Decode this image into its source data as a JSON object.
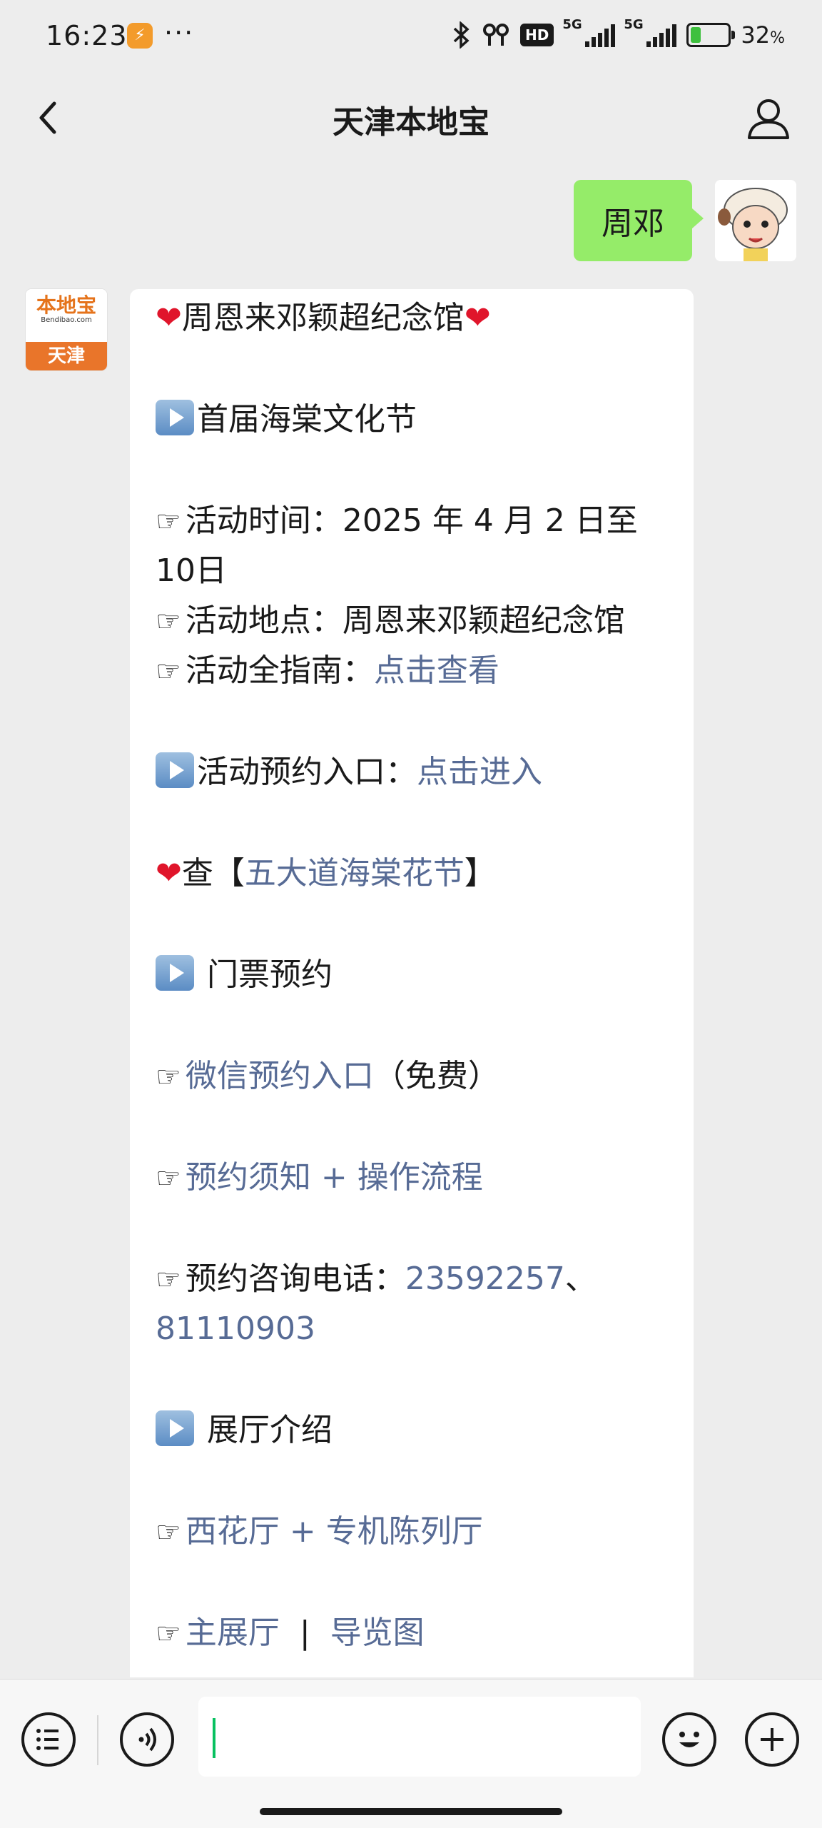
{
  "status_bar": {
    "time": "16:23",
    "more": "···",
    "network_1": "5G",
    "network_2": "5G",
    "hd_badge": "HD",
    "battery_percent": "32",
    "percent_sign": "%",
    "battery_level": 0.32,
    "icons": [
      "bluetooth-icon",
      "earbuds-icon",
      "signal-icon",
      "battery-charging-icon"
    ]
  },
  "header": {
    "title": "天津本地宝",
    "back_icon": "chevron-left-icon",
    "profile_icon": "person-icon"
  },
  "chat": {
    "user_message": "周邓",
    "bot_avatar": {
      "logo_text": "本地宝",
      "url_text": "Bendibao.com",
      "city": "天津"
    },
    "message": {
      "title": "周恩来邓颖超纪念馆",
      "section1_title": "首届海棠文化节",
      "time_label": "活动时间：",
      "time_value": "2025 年 4 月 2 日至",
      "time_value_cont": "10日",
      "place_label": "活动地点：",
      "place_value": "周恩来邓颖超纪念馆",
      "guide_label": "活动全指南：",
      "guide_link": "点击查看",
      "booking_label": "活动预约入口：",
      "booking_link": "点击进入",
      "check_prefix": "查【",
      "check_link": "五大道海棠花节",
      "check_suffix": "】",
      "section2_title": "门票预约",
      "wechat_link": "微信预约入口",
      "wechat_suffix": "（免费）",
      "notice_link": "预约须知 + 操作流程",
      "phone_label": "预约咨询电话：",
      "phone_1": "23592257",
      "phone_sep": "、",
      "phone_2": "81110903",
      "section3_title": "展厅介绍",
      "hall_link": "西花厅 + 专机陈列厅",
      "main_hall_link": "主展厅",
      "divider": "|",
      "map_link": "导览图"
    }
  },
  "input_bar": {
    "menu_icon": "list-menu-icon",
    "voice_icon": "voice-icon",
    "emoji_icon": "emoji-icon",
    "add_icon": "plus-icon"
  }
}
